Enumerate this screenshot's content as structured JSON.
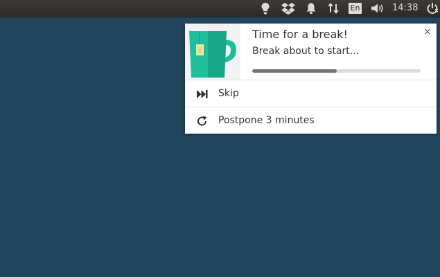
{
  "panel": {
    "icons": [
      "lightbulb-icon",
      "dropbox-icon",
      "bell-icon",
      "network-transfer-icon",
      "volume-icon",
      "power-icon"
    ],
    "language": "En",
    "clock": "14:38"
  },
  "notification": {
    "title": "Time for a break!",
    "body": "Break about to start...",
    "progress": 0.5,
    "close_label": "×",
    "icon": "tea-mug-icon",
    "colors": {
      "mug": "#1fbf9c",
      "mug_shadow": "#17a688",
      "tea_tag": "#f2e8a8"
    },
    "actions": [
      {
        "icon": "skip-forward-icon",
        "label": "Skip"
      },
      {
        "icon": "refresh-icon",
        "label": "Postpone 3 minutes"
      }
    ]
  }
}
